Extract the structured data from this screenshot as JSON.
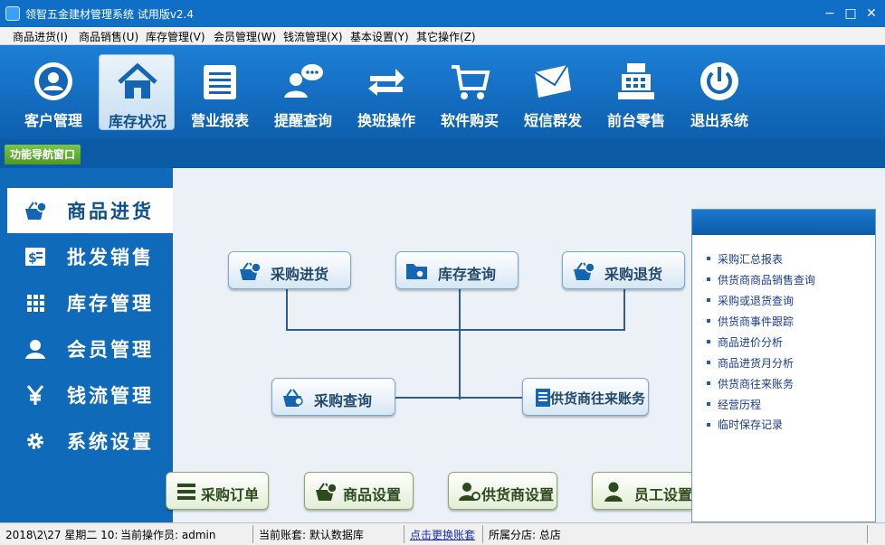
{
  "window": {
    "title": "领智五金建材管理系统 试用版v2.4",
    "min": "−",
    "max": "□",
    "close": "✕"
  },
  "menu": [
    {
      "label": "商品进货(I)"
    },
    {
      "label": "商品销售(U)"
    },
    {
      "label": "库存管理(V)"
    },
    {
      "label": "会员管理(W)"
    },
    {
      "label": "钱流管理(X)"
    },
    {
      "label": "基本设置(Y)"
    },
    {
      "label": "其它操作(Z)"
    }
  ],
  "toolbar": [
    {
      "label": "客户管理",
      "icon": "customer-icon"
    },
    {
      "label": "库存状况",
      "icon": "home-icon",
      "active": true
    },
    {
      "label": "营业报表",
      "icon": "report-icon"
    },
    {
      "label": "提醒查询",
      "icon": "chat-user-icon"
    },
    {
      "label": "换班操作",
      "icon": "swap-icon"
    },
    {
      "label": "软件购买",
      "icon": "cart-icon"
    },
    {
      "label": "短信群发",
      "icon": "envelope-icon"
    },
    {
      "label": "前台零售",
      "icon": "cash-register-icon"
    },
    {
      "label": "退出系统",
      "icon": "power-icon"
    }
  ],
  "nav_tab": "功能导航窗口",
  "sidebar": [
    {
      "label": "商品进货",
      "icon": "basket-icon",
      "active": true
    },
    {
      "label": "批发销售",
      "icon": "invoice-icon"
    },
    {
      "label": "库存管理",
      "icon": "grid-icon"
    },
    {
      "label": "会员管理",
      "icon": "user-icon"
    },
    {
      "label": "钱流管理",
      "icon": "yen-icon"
    },
    {
      "label": "系统设置",
      "icon": "gear-icon"
    }
  ],
  "flow": {
    "purchase_in": "采购进货",
    "stock_query": "库存查询",
    "purchase_return": "采购退货",
    "purchase_query": "采购查询",
    "supplier_account": "供货商往来账务",
    "purchase_order": "采购订单",
    "goods_setting": "商品设置",
    "supplier_setting": "供货商设置",
    "staff_setting": "员工设置"
  },
  "links": [
    "采购汇总报表",
    "供货商商品销售查询",
    "采购或退货查询",
    "供货商事件跟踪",
    "商品进价分析",
    "商品进货月分析",
    "供货商往来账务",
    "经营历程",
    "临时保存记录"
  ],
  "status": {
    "datetime": "2018\\2\\27 星期二 10:",
    "operator": "当前操作员: admin",
    "account": "当前账套: 默认数据库",
    "switch_account": "点击更换账套",
    "branch": "所属分店: 总店"
  },
  "colors": {
    "brand_blue": "#0f6fc7",
    "nav_green": "#5aa62a",
    "link_blue": "#1a3b8f"
  }
}
